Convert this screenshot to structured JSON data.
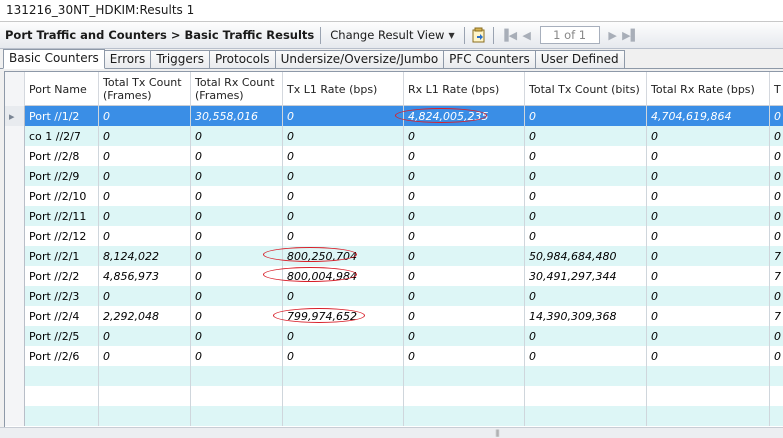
{
  "window": {
    "title": "131216_30NT_HDKIM:Results 1"
  },
  "toolbar": {
    "breadcrumb": "Port Traffic and Counters > Basic Traffic Results",
    "change_view_label": "Change Result View",
    "page_display": "1 of 1"
  },
  "tabs": [
    {
      "label": "Basic Counters"
    },
    {
      "label": "Errors"
    },
    {
      "label": "Triggers"
    },
    {
      "label": "Protocols"
    },
    {
      "label": "Undersize/Oversize/Jumbo"
    },
    {
      "label": "PFC Counters"
    },
    {
      "label": "User Defined"
    }
  ],
  "table": {
    "columns": [
      "Port Name",
      "Total Tx Count (Frames)",
      "Total Rx Count (Frames)",
      "Tx L1 Rate (bps)",
      "Rx L1 Rate (bps)",
      "Total Tx Count (bits)",
      "Total Rx Rate (bps)",
      "T"
    ],
    "rows": [
      [
        "Port //1/2",
        "0",
        "30,558,016",
        "0",
        "4,824,005,235",
        "0",
        "4,704,619,864",
        "0"
      ],
      [
        "co 1 //2/7",
        "0",
        "0",
        "0",
        "0",
        "0",
        "0",
        "0"
      ],
      [
        "Port //2/8",
        "0",
        "0",
        "0",
        "0",
        "0",
        "0",
        "0"
      ],
      [
        "Port //2/9",
        "0",
        "0",
        "0",
        "0",
        "0",
        "0",
        "0"
      ],
      [
        "Port //2/10",
        "0",
        "0",
        "0",
        "0",
        "0",
        "0",
        "0"
      ],
      [
        "Port //2/11",
        "0",
        "0",
        "0",
        "0",
        "0",
        "0",
        "0"
      ],
      [
        "Port //2/12",
        "0",
        "0",
        "0",
        "0",
        "0",
        "0",
        "0"
      ],
      [
        "Port //2/1",
        "8,124,022",
        "0",
        "800,250,704",
        "0",
        "50,984,684,480",
        "0",
        "7"
      ],
      [
        "Port //2/2",
        "4,856,973",
        "0",
        "800,004,984",
        "0",
        "30,491,297,344",
        "0",
        "7"
      ],
      [
        "Port //2/3",
        "0",
        "0",
        "0",
        "0",
        "0",
        "0",
        "0"
      ],
      [
        "Port //2/4",
        "2,292,048",
        "0",
        "799,974,652",
        "0",
        "14,390,309,368",
        "0",
        "7"
      ],
      [
        "Port //2/5",
        "0",
        "0",
        "0",
        "0",
        "0",
        "0",
        "0"
      ],
      [
        "Port //2/6",
        "0",
        "0",
        "0",
        "0",
        "0",
        "0",
        "0"
      ]
    ],
    "selected_row": 0
  }
}
